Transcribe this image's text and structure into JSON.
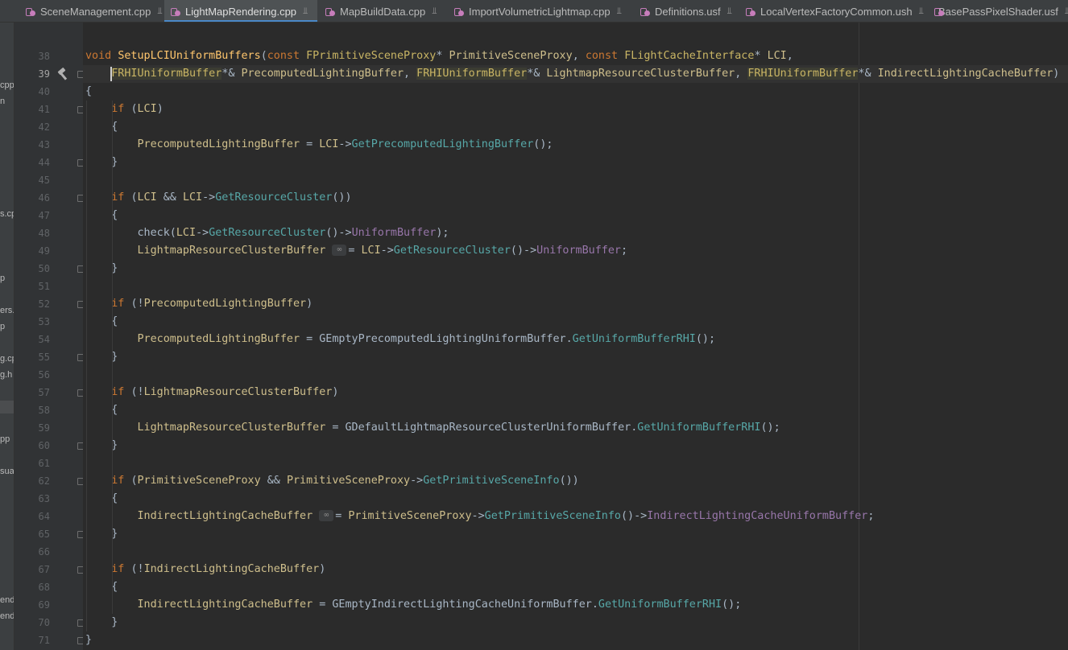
{
  "tabs": [
    {
      "label": "SceneManagement.cpp",
      "active": false
    },
    {
      "label": "LightMapRendering.cpp",
      "active": true
    },
    {
      "label": "MapBuildData.cpp",
      "active": false
    },
    {
      "label": "ImportVolumetricLightmap.cpp",
      "active": false
    },
    {
      "label": "Definitions.usf",
      "active": false
    },
    {
      "label": "LocalVertexFactoryCommon.ush",
      "active": false
    },
    {
      "label": "BasePassPixelShader.usf",
      "active": false
    }
  ],
  "left_panel": {
    "clipped_items": [
      "cpp",
      "n",
      "s.cp",
      "p",
      "ers.",
      "p",
      "g.cp",
      "g.h",
      "pp",
      "sua",
      "end",
      "end"
    ]
  },
  "editor": {
    "current_line": 39,
    "line_numbers": [
      "38",
      "39",
      "40",
      "41",
      "42",
      "43",
      "44",
      "45",
      "46",
      "47",
      "48",
      "49",
      "50",
      "51",
      "52",
      "53",
      "54",
      "55",
      "56",
      "57",
      "58",
      "59",
      "60",
      "61",
      "62",
      "63",
      "64",
      "65",
      "66",
      "67",
      "68",
      "69",
      "70",
      "71"
    ],
    "lines": [
      {
        "n": "38",
        "tokens": [
          [
            "kw",
            "void "
          ],
          [
            "fn",
            "SetupLCIUniformBuffers"
          ],
          [
            "par",
            "("
          ],
          [
            "kw",
            "const "
          ],
          [
            "cls",
            "FPrimitiveSceneProxy"
          ],
          [
            "par",
            "* "
          ],
          [
            "var",
            "PrimitiveSceneProxy"
          ],
          [
            "par",
            ", "
          ],
          [
            "kw",
            "const "
          ],
          [
            "cls",
            "FLightCacheInterface"
          ],
          [
            "par",
            "* "
          ],
          [
            "var",
            "LCI"
          ],
          [
            "par",
            ","
          ]
        ]
      },
      {
        "n": "39",
        "tokens": [
          [
            "par",
            "    "
          ],
          [
            "cls hlbg",
            "FRHIUniformBuffer"
          ],
          [
            "par",
            "*& "
          ],
          [
            "var",
            "PrecomputedLightingBuffer"
          ],
          [
            "par",
            ", "
          ],
          [
            "cls hlbg",
            "FRHIUniformBuffer"
          ],
          [
            "par",
            "*& "
          ],
          [
            "var",
            "LightmapResourceClusterBuffer"
          ],
          [
            "par",
            ", "
          ],
          [
            "cls hlbg",
            "FRHIUniformBuffer"
          ],
          [
            "par",
            "*& "
          ],
          [
            "var",
            "IndirectLightingCacheBuffer"
          ],
          [
            "par",
            ")"
          ]
        ]
      },
      {
        "n": "40",
        "tokens": [
          [
            "par",
            "{"
          ]
        ]
      },
      {
        "n": "41",
        "tokens": [
          [
            "par",
            "    "
          ],
          [
            "kw",
            "if "
          ],
          [
            "par",
            "("
          ],
          [
            "var",
            "LCI"
          ],
          [
            "par",
            ")"
          ]
        ]
      },
      {
        "n": "42",
        "tokens": [
          [
            "par",
            "    {"
          ]
        ]
      },
      {
        "n": "43",
        "tokens": [
          [
            "par",
            "        "
          ],
          [
            "var",
            "PrecomputedLightingBuffer"
          ],
          [
            "par",
            " = "
          ],
          [
            "var",
            "LCI"
          ],
          [
            "par",
            "->"
          ],
          [
            "mth",
            "GetPrecomputedLightingBuffer"
          ],
          [
            "par",
            "();"
          ]
        ]
      },
      {
        "n": "44",
        "tokens": [
          [
            "par",
            "    }"
          ]
        ]
      },
      {
        "n": "45",
        "tokens": []
      },
      {
        "n": "46",
        "tokens": [
          [
            "par",
            "    "
          ],
          [
            "kw",
            "if "
          ],
          [
            "par",
            "("
          ],
          [
            "var",
            "LCI"
          ],
          [
            "par",
            " && "
          ],
          [
            "var",
            "LCI"
          ],
          [
            "par",
            "->"
          ],
          [
            "mth",
            "GetResourceCluster"
          ],
          [
            "par",
            "())"
          ]
        ]
      },
      {
        "n": "47",
        "tokens": [
          [
            "par",
            "    {"
          ]
        ]
      },
      {
        "n": "48",
        "tokens": [
          [
            "par",
            "        check("
          ],
          [
            "var",
            "LCI"
          ],
          [
            "par",
            "->"
          ],
          [
            "mth",
            "GetResourceCluster"
          ],
          [
            "par",
            "()->"
          ],
          [
            "fld",
            "UniformBuffer"
          ],
          [
            "par",
            ");"
          ]
        ]
      },
      {
        "n": "49",
        "tokens": [
          [
            "par",
            "        "
          ],
          [
            "var",
            "LightmapResourceClusterBuffer"
          ],
          [
            "par",
            " "
          ],
          [
            "hint",
            "∞"
          ],
          [
            "par",
            "= "
          ],
          [
            "var",
            "LCI"
          ],
          [
            "par",
            "->"
          ],
          [
            "mth",
            "GetResourceCluster"
          ],
          [
            "par",
            "()->"
          ],
          [
            "fld",
            "UniformBuffer"
          ],
          [
            "par",
            ";"
          ]
        ]
      },
      {
        "n": "50",
        "tokens": [
          [
            "par",
            "    }"
          ]
        ]
      },
      {
        "n": "51",
        "tokens": []
      },
      {
        "n": "52",
        "tokens": [
          [
            "par",
            "    "
          ],
          [
            "kw",
            "if "
          ],
          [
            "par",
            "(!"
          ],
          [
            "var",
            "PrecomputedLightingBuffer"
          ],
          [
            "par",
            ")"
          ]
        ]
      },
      {
        "n": "53",
        "tokens": [
          [
            "par",
            "    {"
          ]
        ]
      },
      {
        "n": "54",
        "tokens": [
          [
            "par",
            "        "
          ],
          [
            "var",
            "PrecomputedLightingBuffer"
          ],
          [
            "par",
            " = GEmptyPrecomputedLightingUniformBuffer."
          ],
          [
            "mth",
            "GetUniformBufferRHI"
          ],
          [
            "par",
            "();"
          ]
        ]
      },
      {
        "n": "55",
        "tokens": [
          [
            "par",
            "    }"
          ]
        ]
      },
      {
        "n": "56",
        "tokens": []
      },
      {
        "n": "57",
        "tokens": [
          [
            "par",
            "    "
          ],
          [
            "kw",
            "if "
          ],
          [
            "par",
            "(!"
          ],
          [
            "var",
            "LightmapResourceClusterBuffer"
          ],
          [
            "par",
            ")"
          ]
        ]
      },
      {
        "n": "58",
        "tokens": [
          [
            "par",
            "    {"
          ]
        ]
      },
      {
        "n": "59",
        "tokens": [
          [
            "par",
            "        "
          ],
          [
            "var",
            "LightmapResourceClusterBuffer"
          ],
          [
            "par",
            " = GDefaultLightmapResourceClusterUniformBuffer."
          ],
          [
            "mth",
            "GetUniformBufferRHI"
          ],
          [
            "par",
            "();"
          ]
        ]
      },
      {
        "n": "60",
        "tokens": [
          [
            "par",
            "    }"
          ]
        ]
      },
      {
        "n": "61",
        "tokens": []
      },
      {
        "n": "62",
        "tokens": [
          [
            "par",
            "    "
          ],
          [
            "kw",
            "if "
          ],
          [
            "par",
            "("
          ],
          [
            "var",
            "PrimitiveSceneProxy"
          ],
          [
            "par",
            " && "
          ],
          [
            "var",
            "PrimitiveSceneProxy"
          ],
          [
            "par",
            "->"
          ],
          [
            "mth",
            "GetPrimitiveSceneInfo"
          ],
          [
            "par",
            "())"
          ]
        ]
      },
      {
        "n": "63",
        "tokens": [
          [
            "par",
            "    {"
          ]
        ]
      },
      {
        "n": "64",
        "tokens": [
          [
            "par",
            "        "
          ],
          [
            "var",
            "IndirectLightingCacheBuffer"
          ],
          [
            "par",
            " "
          ],
          [
            "hint",
            "∞"
          ],
          [
            "par",
            "= "
          ],
          [
            "var",
            "PrimitiveSceneProxy"
          ],
          [
            "par",
            "->"
          ],
          [
            "mth",
            "GetPrimitiveSceneInfo"
          ],
          [
            "par",
            "()->"
          ],
          [
            "fld",
            "IndirectLightingCacheUniformBuffer"
          ],
          [
            "par",
            ";"
          ]
        ]
      },
      {
        "n": "65",
        "tokens": [
          [
            "par",
            "    }"
          ]
        ]
      },
      {
        "n": "66",
        "tokens": []
      },
      {
        "n": "67",
        "tokens": [
          [
            "par",
            "    "
          ],
          [
            "kw",
            "if "
          ],
          [
            "par",
            "(!"
          ],
          [
            "var",
            "IndirectLightingCacheBuffer"
          ],
          [
            "par",
            ")"
          ]
        ]
      },
      {
        "n": "68",
        "tokens": [
          [
            "par",
            "    {"
          ]
        ]
      },
      {
        "n": "69",
        "tokens": [
          [
            "par",
            "        "
          ],
          [
            "var",
            "IndirectLightingCacheBuffer"
          ],
          [
            "par",
            " = GEmptyIndirectLightingCacheUniformBuffer."
          ],
          [
            "mth",
            "GetUniformBufferRHI"
          ],
          [
            "par",
            "();"
          ]
        ]
      },
      {
        "n": "70",
        "tokens": [
          [
            "par",
            "    }"
          ]
        ]
      },
      {
        "n": "71",
        "tokens": [
          [
            "par",
            "}"
          ]
        ]
      }
    ],
    "fold_markers": [
      "39",
      "41",
      "44",
      "46",
      "50",
      "52",
      "55",
      "57",
      "60",
      "62",
      "65",
      "67",
      "70",
      "71"
    ]
  },
  "colors": {
    "background": "#2b2b2b",
    "gutter": "#313335",
    "keyword": "#cc7832",
    "class": "#c9b564",
    "function": "#ffc66d",
    "method": "#57a8a8",
    "field": "#9876aa",
    "variable": "#cfbf8c"
  }
}
